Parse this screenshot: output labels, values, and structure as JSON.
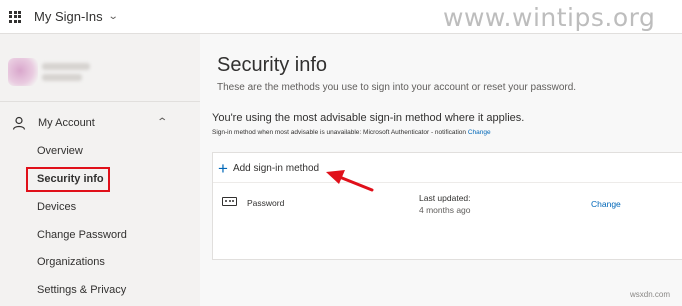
{
  "app": {
    "title": "My Sign-Ins"
  },
  "watermark": "www.wintips.org",
  "sidebar": {
    "account_label": "My Account",
    "items": [
      {
        "label": "Overview",
        "active": false
      },
      {
        "label": "Security info",
        "active": true
      },
      {
        "label": "Devices",
        "active": false
      },
      {
        "label": "Change Password",
        "active": false
      },
      {
        "label": "Organizations",
        "active": false
      },
      {
        "label": "Settings & Privacy",
        "active": false
      }
    ]
  },
  "main": {
    "title": "Security info",
    "subtitle": "These are the methods you use to sign into your account or reset your password.",
    "advisable_text": "You're using the most advisable sign-in method where it applies.",
    "advisable_note": "Sign-in method when most advisable is unavailable: Microsoft Authenticator - notification",
    "advisable_note_link": "Change",
    "add_method_label": "Add sign-in method",
    "methods": [
      {
        "name": "Password",
        "last_updated_label": "Last updated:",
        "last_updated_value": "4 months ago",
        "action_label": "Change"
      }
    ]
  },
  "colors": {
    "accent": "#0067b8",
    "highlight": "#e0101a",
    "sidebar_bg": "#f3f2f1"
  },
  "icons": [
    "app-launcher-icon",
    "chevron-down-icon",
    "person-icon",
    "chevron-up-icon",
    "plus-icon",
    "password-icon"
  ],
  "footer_watermark": "wsxdn.com"
}
